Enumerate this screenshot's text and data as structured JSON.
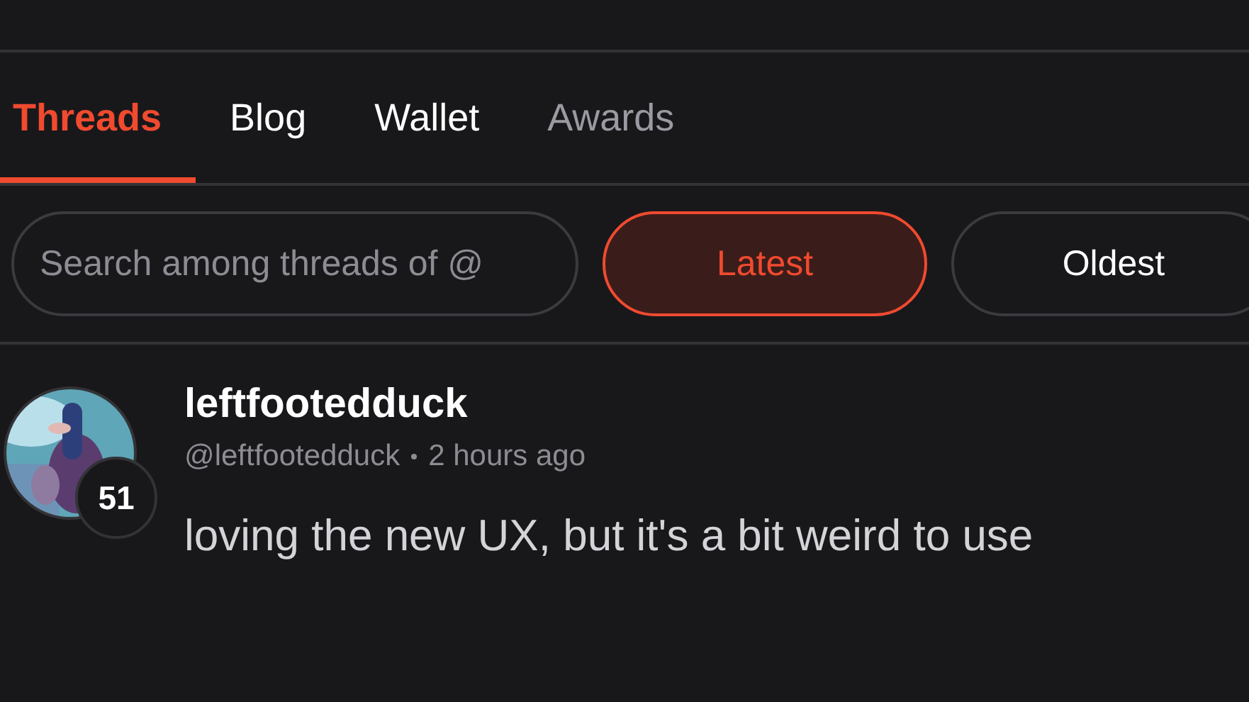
{
  "tabs": [
    {
      "label": "Threads",
      "selected": true
    },
    {
      "label": "Blog",
      "selected": false
    },
    {
      "label": "Wallet",
      "selected": false
    },
    {
      "label": "Awards",
      "selected": false
    }
  ],
  "search": {
    "placeholder": "Search among threads of @"
  },
  "sort_buttons": [
    {
      "label": "Latest",
      "selected": true
    },
    {
      "label": "Oldest",
      "selected": false
    }
  ],
  "post": {
    "author": "leftfootedduck",
    "handle": "@leftfootedduck",
    "time": "2 hours ago",
    "reputation": "51",
    "body": "loving the new UX, but it's a bit weird to use"
  }
}
